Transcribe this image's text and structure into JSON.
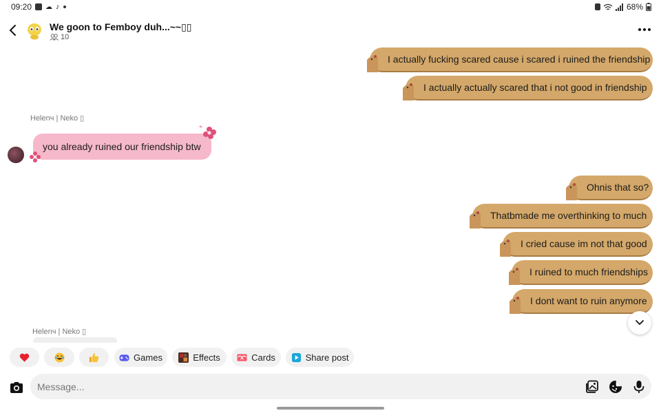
{
  "status_bar": {
    "time": "09:20",
    "battery": "68%"
  },
  "header": {
    "title": "We goon to Femboy duh...~~▯▯",
    "member_count": "10"
  },
  "messages": {
    "out_1": "I actually fucking scared cause i scared i ruined the friendship",
    "out_2": "I actually actually scared that i not good in friendship",
    "sender_1": "Helenч | Neko ▯",
    "in_1": "you already ruined our friendship btw",
    "out_3": "Ohnis that so?",
    "out_4": "Thatbmade me overthinking to much",
    "out_5": "I cried cause im not that good",
    "out_6": "I ruined to much friendships",
    "out_7": "I dont want to ruin anymore",
    "sender_2": "Helenч | Neko ▯"
  },
  "quick_actions": {
    "games": "Games",
    "effects": "Effects",
    "cards": "Cards",
    "share_post": "Share post"
  },
  "composer": {
    "placeholder": "Message..."
  },
  "colors": {
    "outgoing_bubble": "#d4a86a",
    "incoming_bubble": "#f6b8cb",
    "chip_bg": "#f1f1f2"
  },
  "icons": [
    "back-arrow-icon",
    "group-avatar-icon",
    "members-icon",
    "more-icon",
    "heart-icon",
    "laugh-emoji-icon",
    "thumbs-up-icon",
    "games-icon",
    "effects-icon",
    "cards-icon",
    "share-post-icon",
    "camera-icon",
    "gallery-icon",
    "sticker-icon",
    "mic-icon",
    "chevron-down-icon"
  ]
}
